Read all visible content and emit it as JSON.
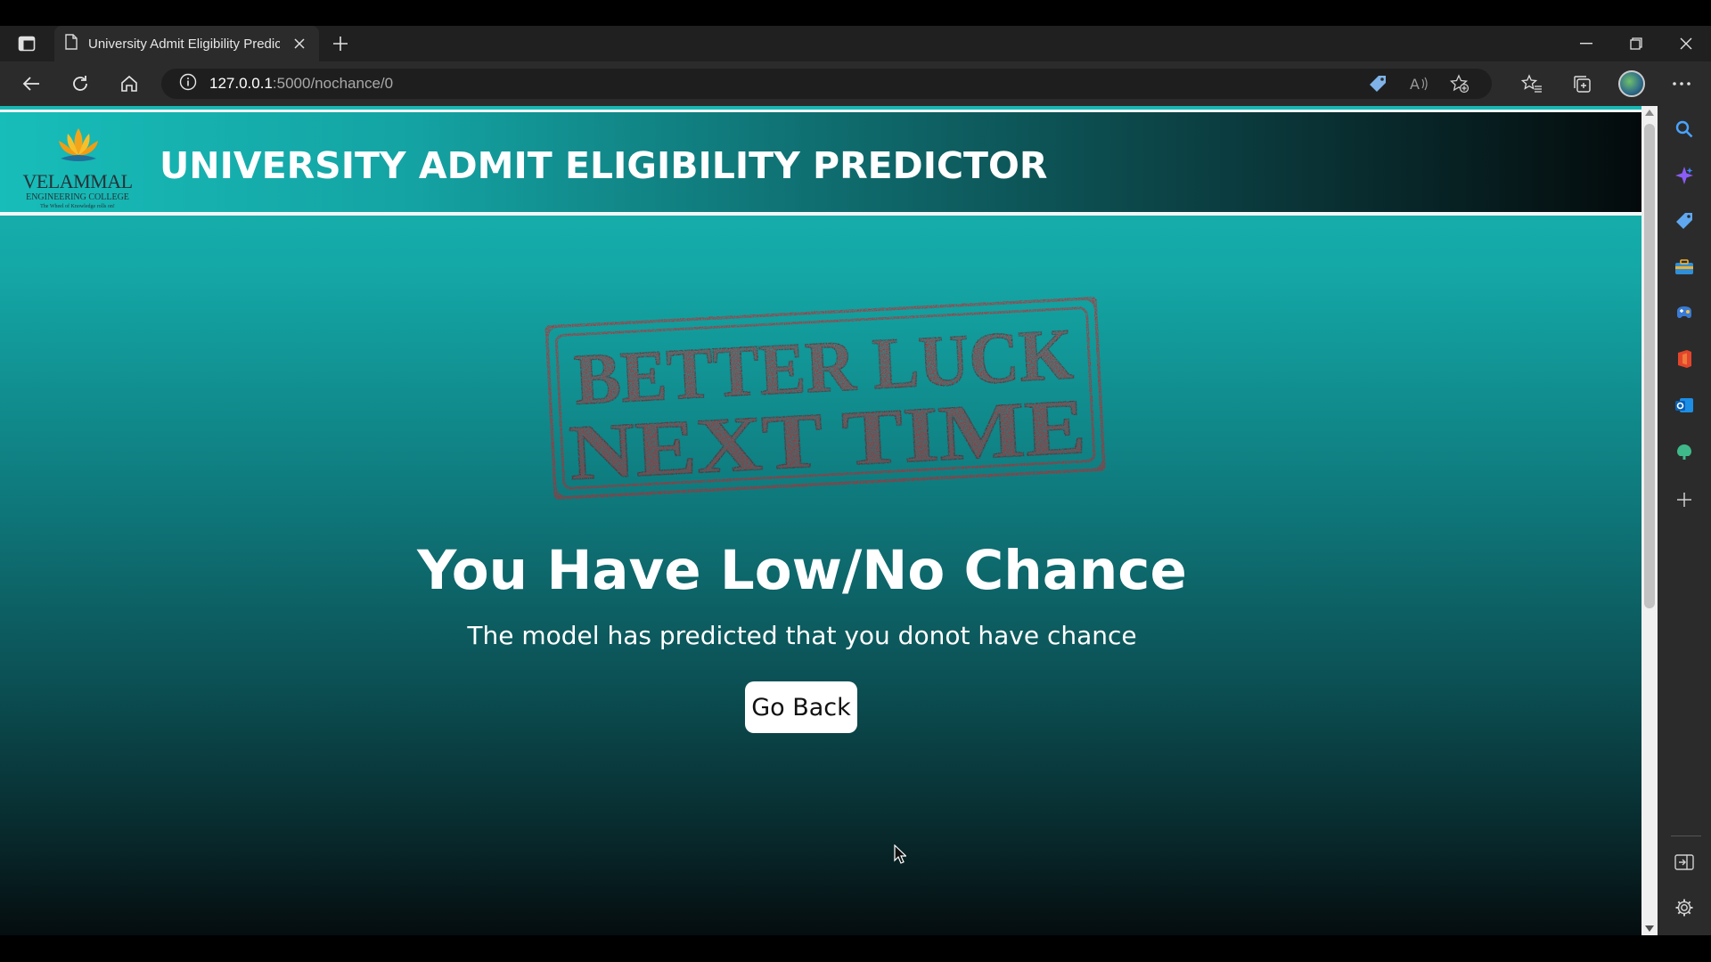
{
  "browser": {
    "tab_title": "University Admit Eligibility Predic",
    "url_host": "127.0.0.1",
    "url_path": ":5000/nochance/0"
  },
  "header": {
    "logo": {
      "name": "VELAMMAL",
      "subtitle": "ENGINEERING COLLEGE",
      "tagline": "The Wheel of Knowledge rolls on!"
    },
    "title": "UNIVERSITY ADMIT ELIGIBILITY PREDICTOR"
  },
  "stamp": {
    "line1": "BETTER LUCK",
    "line2": "NEXT TIME",
    "color": "#e0151b"
  },
  "result": {
    "headline": "You Have Low/No Chance",
    "message": "The model has predicted that you donot have chance",
    "button_label": "Go Back"
  },
  "sidebar": {
    "icons": [
      "search-icon",
      "copilot-icon",
      "shopping-icon",
      "tools-icon",
      "games-icon",
      "office-icon",
      "outlook-icon",
      "drop-icon",
      "add-icon",
      "split-screen-icon",
      "settings-icon"
    ]
  },
  "colors": {
    "page_gradient_top": "#17b8b4",
    "page_gradient_bottom": "#050d0f",
    "header_border": "#f4f7f7"
  }
}
